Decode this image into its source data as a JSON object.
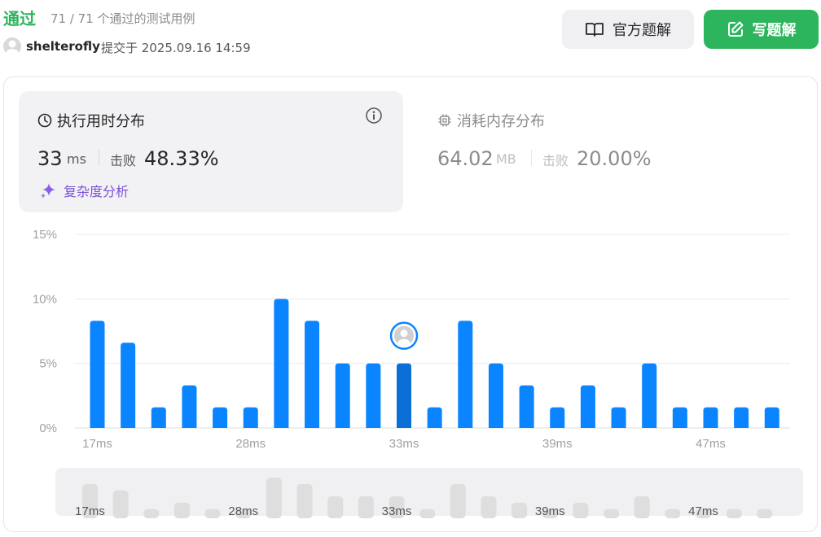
{
  "header": {
    "status": "通过",
    "cases": "71 / 71 个通过的测试用例",
    "username": "shelterofly",
    "submitted": "提交于 2025.09.16 14:59",
    "official_solution_label": "官方题解",
    "write_solution_label": "写题解"
  },
  "runtime": {
    "title": "执行用时分布",
    "value": "33",
    "unit": "ms",
    "beats_label": "击败",
    "beats_pct": "48.33%",
    "complexity_label": "复杂度分析"
  },
  "memory": {
    "title": "消耗内存分布",
    "value": "64.02",
    "unit": "MB",
    "beats_label": "击败",
    "beats_pct": "20.00%"
  },
  "colors": {
    "accent_green": "#2db55d",
    "bar_blue": "#0a84ff",
    "bar_highlight": "#0a6fd6",
    "complexity_purple": "#7b4fd6"
  },
  "chart_data": {
    "type": "bar",
    "ylabel": "",
    "yticks": [
      "0%",
      "5%",
      "10%",
      "15%"
    ],
    "ylim": [
      0,
      15
    ],
    "xtick_labels": [
      "17ms",
      "28ms",
      "33ms",
      "39ms",
      "47ms"
    ],
    "values": [
      8.3,
      6.6,
      1.6,
      3.3,
      1.6,
      1.6,
      10.0,
      8.3,
      5.0,
      5.0,
      5.0,
      1.6,
      8.3,
      5.0,
      3.3,
      1.6,
      3.3,
      1.6,
      5.0,
      1.6,
      1.6,
      1.6,
      1.6
    ],
    "highlight_index": 10,
    "grid": true
  },
  "minimap": {
    "xtick_labels": [
      "17ms",
      "28ms",
      "33ms",
      "39ms",
      "47ms"
    ]
  }
}
